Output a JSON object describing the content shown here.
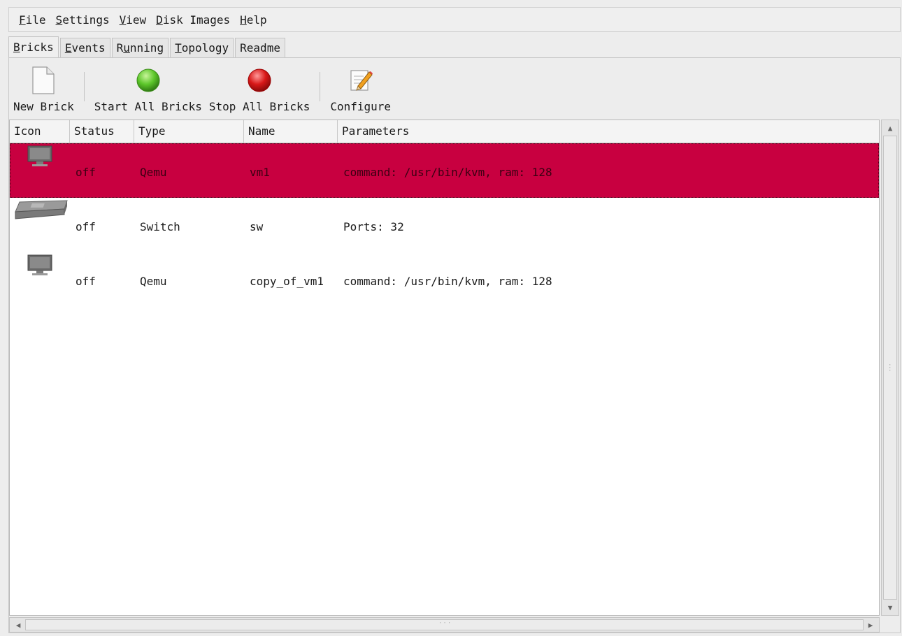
{
  "menubar": {
    "items": [
      {
        "pre": "",
        "u": "F",
        "post": "ile"
      },
      {
        "pre": "",
        "u": "S",
        "post": "ettings"
      },
      {
        "pre": "",
        "u": "V",
        "post": "iew"
      },
      {
        "pre": "",
        "u": "D",
        "post": "isk Images"
      },
      {
        "pre": "",
        "u": "H",
        "post": "elp"
      }
    ]
  },
  "tabs": [
    {
      "pre": "",
      "u": "B",
      "post": "ricks",
      "active": true
    },
    {
      "pre": "",
      "u": "E",
      "post": "vents"
    },
    {
      "pre": "R",
      "u": "u",
      "post": "nning"
    },
    {
      "pre": "",
      "u": "T",
      "post": "opology"
    },
    {
      "pre": "Readme",
      "u": "",
      "post": ""
    }
  ],
  "toolbar": {
    "new_brick": "New Brick",
    "start_all": "Start All Bricks",
    "stop_all": "Stop All Bricks",
    "configure": "Configure",
    "start_color": "#5cc62a",
    "stop_color": "#d81818"
  },
  "table": {
    "columns": [
      "Icon",
      "Status",
      "Type",
      "Name",
      "Parameters"
    ],
    "rows": [
      {
        "icon": "monitor-icon",
        "status": "off",
        "type": "Qemu",
        "name": "vm1",
        "parameters": "command: /usr/bin/kvm, ram: 128",
        "selected": true
      },
      {
        "icon": "switch-icon",
        "status": "off",
        "type": "Switch",
        "name": "sw",
        "parameters": "Ports: 32",
        "selected": false
      },
      {
        "icon": "monitor-icon",
        "status": "off",
        "type": "Qemu",
        "name": "copy_of_vm1",
        "parameters": "command: /usr/bin/kvm, ram: 128",
        "selected": false
      }
    ]
  },
  "colors": {
    "selection": "#c80040"
  }
}
